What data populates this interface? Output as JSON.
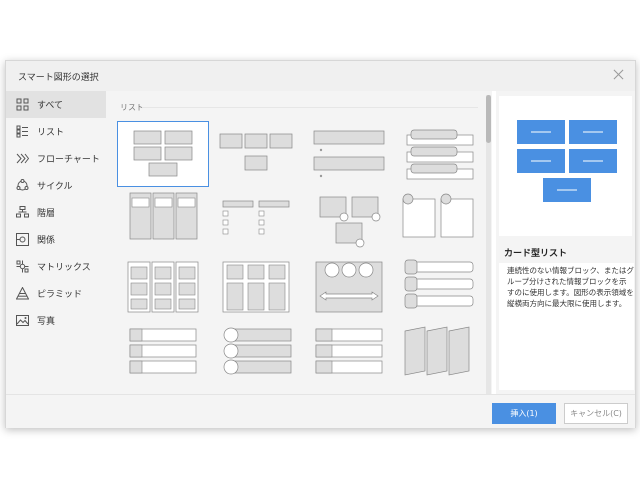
{
  "dialog": {
    "title": "スマート図形の選択"
  },
  "sidebar": {
    "items": [
      {
        "label": "すべて",
        "icon": "grid-icon"
      },
      {
        "label": "リスト",
        "icon": "list-icon"
      },
      {
        "label": "フローチャート",
        "icon": "chevrons-icon"
      },
      {
        "label": "サイクル",
        "icon": "cycle-icon"
      },
      {
        "label": "階層",
        "icon": "hierarchy-icon"
      },
      {
        "label": "関係",
        "icon": "relation-icon"
      },
      {
        "label": "マトリックス",
        "icon": "matrix-icon"
      },
      {
        "label": "ピラミッド",
        "icon": "pyramid-icon"
      },
      {
        "label": "写真",
        "icon": "photo-icon"
      }
    ]
  },
  "gallery": {
    "group_label": "リスト"
  },
  "preview": {
    "title": "カード型リスト",
    "description": "連続性のない情報ブロック、またはグループ分けされた情報ブロックを示すのに使用します。図形の表示領域を縦横両方向に最大限に使用します。"
  },
  "footer": {
    "insert_label": "挿入(1)",
    "cancel_label": "キャンセル(C)"
  },
  "colors": {
    "accent": "#4a90e2",
    "selection_border": "#4a90e2"
  }
}
